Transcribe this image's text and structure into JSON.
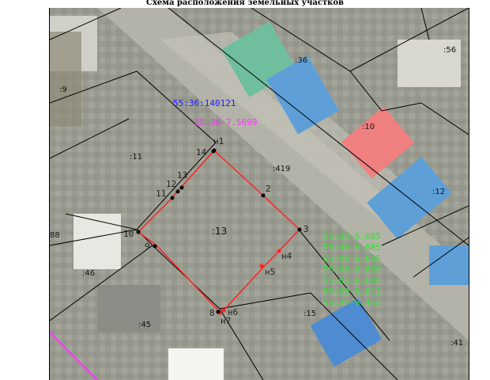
{
  "title": "Схема расположения земельных участков",
  "quarter_number": "55:36:140121",
  "zone_code": "55:36-7.5699",
  "green_zones": [
    "55:00-6.685",
    "55:00-6.685",
    "55:00-6.685",
    "55:00-6.685",
    "55:03-6.685",
    "55:00-6.611",
    "55:24-6.453"
  ],
  "parcel_labels": [
    ":9",
    ":36",
    ":56",
    ":10",
    ":11",
    ":419",
    ":12",
    ":13",
    "88",
    ":46",
    ":45",
    ":15",
    ":41"
  ],
  "point_labels": [
    "н1",
    "2",
    "3",
    "н4",
    "н5",
    "н6",
    "н7",
    "8",
    "9",
    "10",
    "11",
    "12",
    "13",
    "14"
  ],
  "colors": {
    "boundary": "#ff2222",
    "cadastral_lines": "#000000",
    "quarter": "#1a1aff",
    "zone": "#ff33ff",
    "green_zone": "#33dd33"
  }
}
